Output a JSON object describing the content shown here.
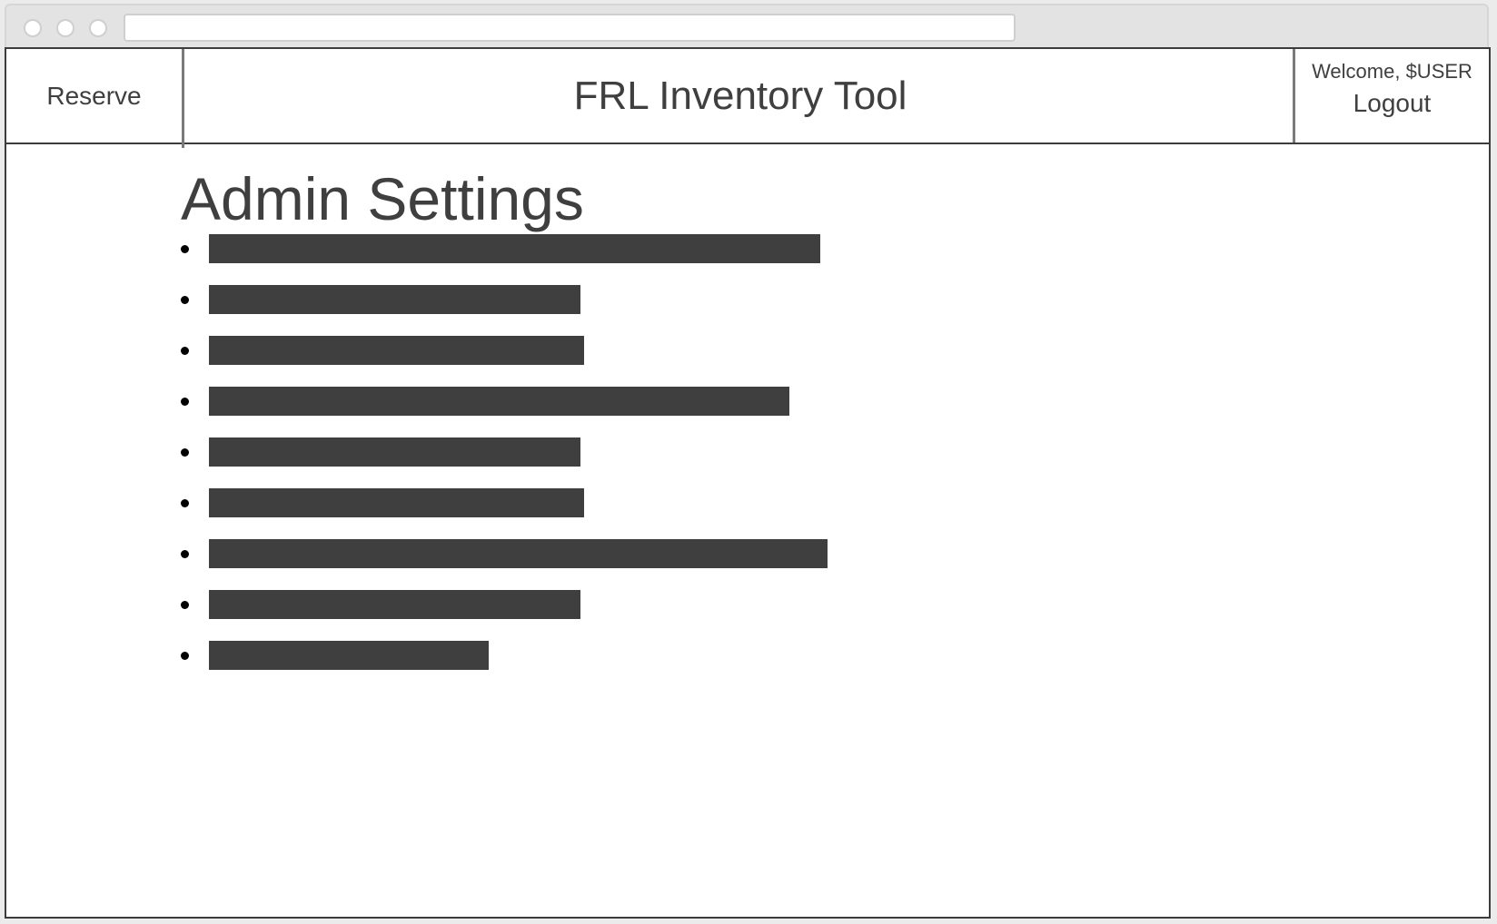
{
  "header": {
    "reserve_label": "Reserve",
    "app_title": "FRL Inventory Tool",
    "welcome_text": "Welcome, $USER",
    "logout_label": "Logout"
  },
  "main": {
    "page_title": "Admin Settings",
    "settings_items": [
      {
        "fill": 1.0
      },
      {
        "fill": 0.608
      },
      {
        "fill": 0.614
      },
      {
        "fill": 0.95
      },
      {
        "fill": 0.608
      },
      {
        "fill": 0.614
      },
      {
        "fill": 1.012
      },
      {
        "fill": 0.608
      },
      {
        "fill": 0.458
      }
    ]
  },
  "colors": {
    "text": "#3f3f3f",
    "bar": "#3f3f3f",
    "border": "#3c3c3c"
  }
}
